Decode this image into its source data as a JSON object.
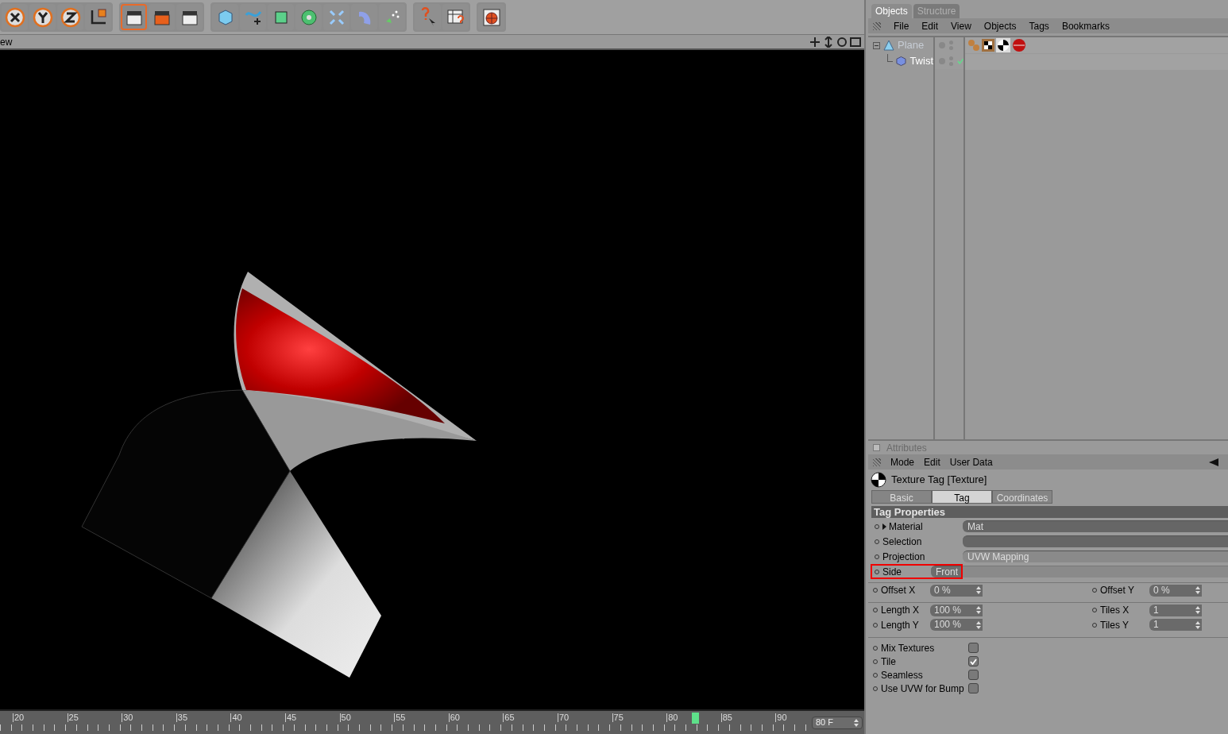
{
  "viewport": {
    "title": "ew"
  },
  "timeline": {
    "ticks": [
      "20",
      "25",
      "30",
      "35",
      "40",
      "45",
      "50",
      "55",
      "60",
      "65",
      "70",
      "75",
      "80",
      "85",
      "90"
    ],
    "playhead": {
      "level": 0.86
    },
    "frame_field": {
      "value": "80 F"
    }
  },
  "object_manager": {
    "tabs": [
      {
        "label": "Objects",
        "selected": true
      },
      {
        "label": "Structure",
        "selected": false
      }
    ],
    "menu": [
      "File",
      "Edit",
      "View",
      "Objects",
      "Tags",
      "Bookmarks"
    ],
    "objects": [
      {
        "name": "Plane",
        "dimmed": true,
        "checked": false,
        "children": [
          {
            "name": "Twist",
            "dimmed": false,
            "checked": true
          }
        ]
      }
    ]
  },
  "attributes": {
    "title": "Attributes",
    "menu": [
      "Mode",
      "Edit",
      "User Data"
    ],
    "object_title": "Texture Tag [Texture]",
    "tabs": [
      {
        "label": "Basic",
        "selected": false
      },
      {
        "label": "Tag",
        "selected": true
      },
      {
        "label": "Coordinates",
        "selected": false
      }
    ],
    "section": "Tag Properties",
    "properties": [
      {
        "kind": "link",
        "label": "Material",
        "value": "Mat",
        "highlighted": false
      },
      {
        "kind": "link_empty",
        "label": "Selection",
        "highlighted": false
      },
      {
        "kind": "dropdown",
        "label": "Projection",
        "value": "UVW Mapping",
        "highlighted": false
      },
      {
        "kind": "dropdown",
        "label": "Side",
        "value": "Front",
        "highlighted": true
      }
    ],
    "number_rows": [
      [
        {
          "label": "Offset X",
          "value": "0 %"
        },
        {
          "label": "Offset Y",
          "value": "0 %"
        }
      ],
      [
        {
          "label": "Length X",
          "value": "100 %"
        },
        {
          "label": "Tiles X",
          "value": "1"
        }
      ],
      [
        {
          "label": "Length Y",
          "value": "100 %"
        },
        {
          "label": "Tiles Y",
          "value": "1"
        }
      ]
    ],
    "checkboxes": [
      {
        "label": "Mix Textures",
        "checked": false
      },
      {
        "label": "Tile",
        "checked": true
      },
      {
        "label": "Seamless",
        "checked": false
      },
      {
        "label": "Use UVW for Bump",
        "checked": false
      }
    ]
  }
}
